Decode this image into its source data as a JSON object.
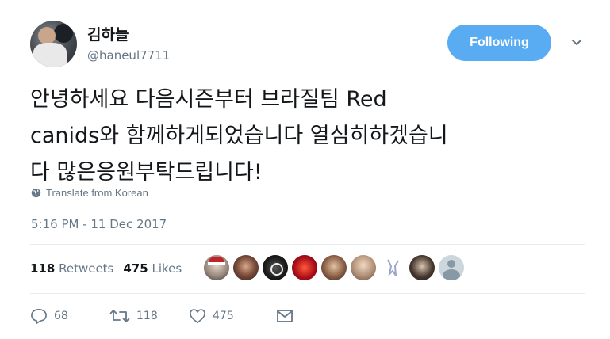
{
  "tweet": {
    "display_name": "김하늘",
    "handle": "@haneul7711",
    "follow_label": "Following",
    "text_lines": [
      "안녕하세요 다음시즌부터 브라질팀 Red",
      "canids와 함께하게되었습니다 열심히하겠습니",
      "다 많은응원부탁드립니다!"
    ],
    "translate_label": "Translate from Korean",
    "timestamp": "5:16 PM - 11 Dec 2017",
    "stats": {
      "retweets_count": "118",
      "retweets_label": "Retweets",
      "likes_count": "475",
      "likes_label": "Likes"
    },
    "actions": {
      "reply_count": "68",
      "retweet_count": "118",
      "like_count": "475"
    },
    "accent_color": "#5aacf2",
    "icons": [
      "globe-icon",
      "chevron-down-icon",
      "reply-icon",
      "retweet-icon",
      "heart-icon",
      "message-icon"
    ]
  }
}
